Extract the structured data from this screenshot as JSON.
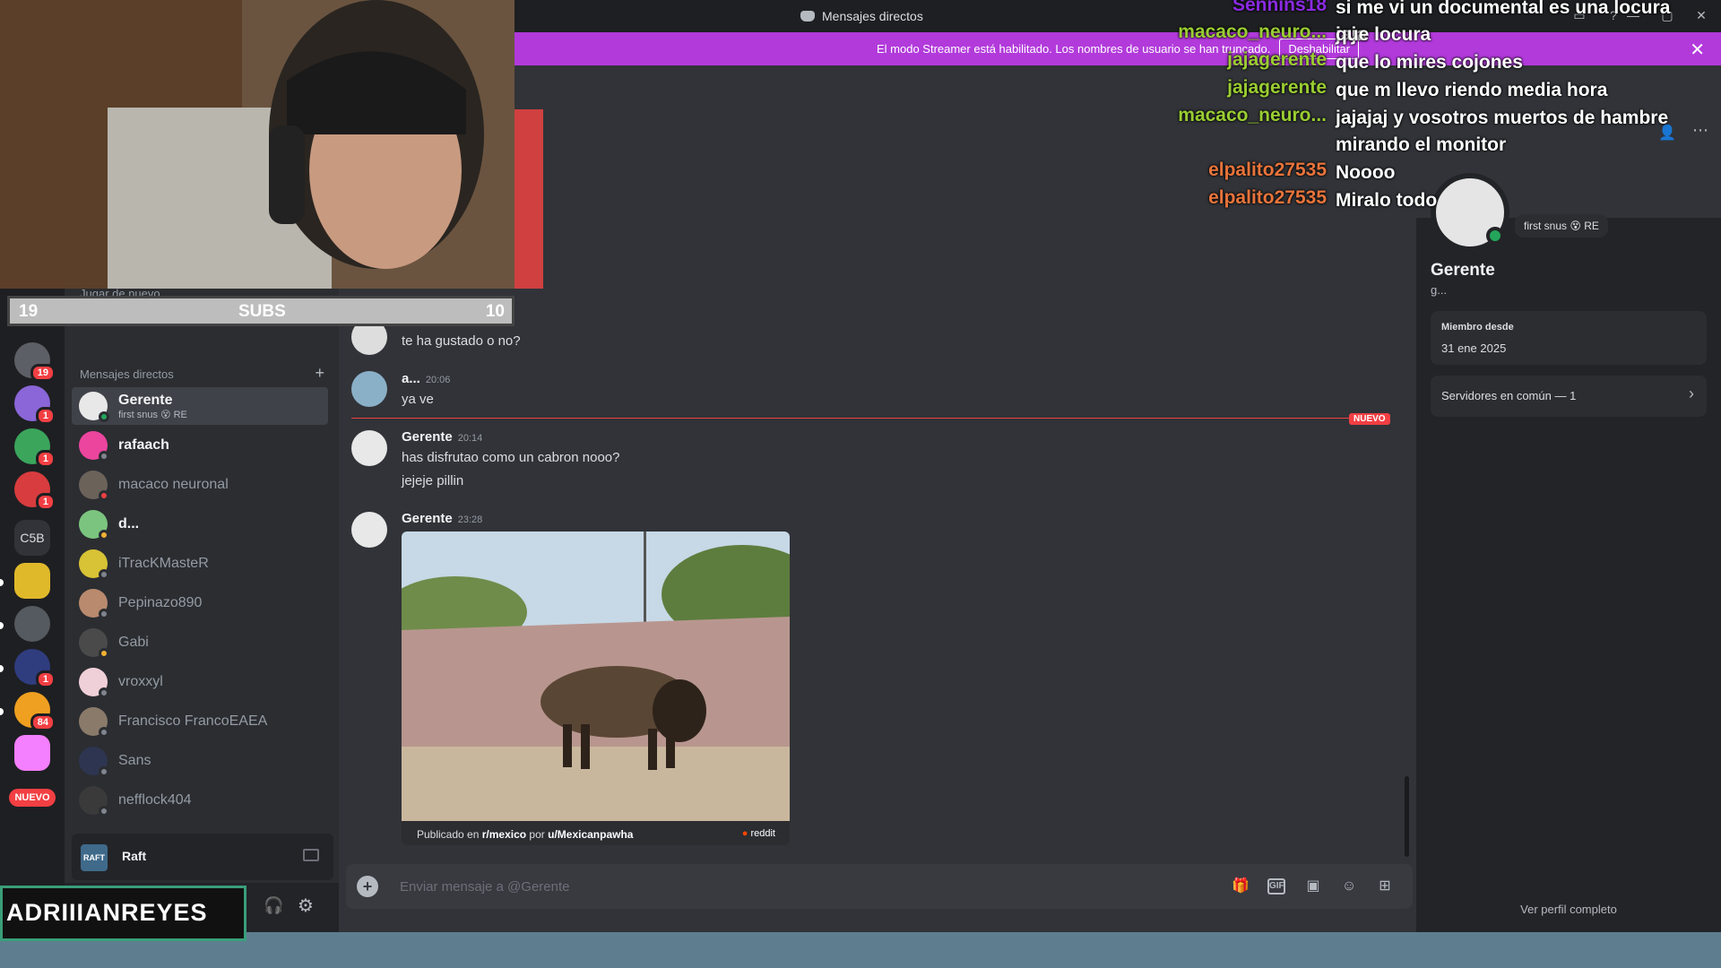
{
  "window": {
    "title": "Mensajes directos",
    "help_icon": "help-icon",
    "minimize_icon": "minimize-icon",
    "maximize_icon": "maximize-icon",
    "close_icon": "close-icon"
  },
  "streamer_banner": {
    "text": "El modo Streamer está habilitado. Los nombres de usuario se han truncado.",
    "button": "Deshabilitar"
  },
  "server_rail": {
    "badges": [
      "19",
      "1",
      "1",
      "1",
      "1",
      "84"
    ],
    "c5b_label": "C5B",
    "new_label": "NUEVO"
  },
  "sidebar": {
    "partial_label": "Jugar de nuevo",
    "dm_header": "Mensajes directos",
    "dms": [
      {
        "name": "Gerente",
        "sub": "first snus 😵 RE"
      },
      {
        "name": "rafaach"
      },
      {
        "name": "macaco neuronal"
      },
      {
        "name": "d..."
      },
      {
        "name": "iTracKMasteR"
      },
      {
        "name": "Pepinazo890"
      },
      {
        "name": "Gabi"
      },
      {
        "name": "vroxxyl"
      },
      {
        "name": "Francisco FrancoEAEA"
      },
      {
        "name": "Sans"
      },
      {
        "name": "nefflock404"
      }
    ],
    "activity": {
      "game": "Raft",
      "icon_text": "RAFT"
    }
  },
  "chat": {
    "messages": [
      {
        "text": "te ha gustado o no?"
      },
      {
        "author": "a...",
        "time": "20:06",
        "text": "ya ve"
      },
      {
        "author": "Gerente",
        "time": "20:14",
        "lines": [
          "has disfrutao como un cabron nooo?",
          "jejeje pillin"
        ]
      },
      {
        "author": "Gerente",
        "time": "23:28"
      }
    ],
    "new_marker": "NUEVO",
    "embed": {
      "caption_prefix": "Publicado en ",
      "subreddit": "r/mexico",
      "by": " por ",
      "user": "u/Mexicanpawha",
      "source": "reddit"
    },
    "composer_placeholder": "Enviar mensaje a @Gerente"
  },
  "profile": {
    "name": "Gerente",
    "tag": "g...",
    "status": "first snus 😵 RE",
    "member_since_label": "Miembro desde",
    "member_since": "31 ene 2025",
    "servers_label": "Servidores en común — 1",
    "view_full": "Ver perfil completo"
  },
  "overlay": {
    "subs_left": "19",
    "subs_label": "SUBS",
    "subs_right": "10",
    "streamer_name": "ADRIIIANREYES",
    "twitch_chat": [
      {
        "user": "Sennins18",
        "color": "#8a2be2",
        "msg": "si me vi un documental es una locura jaja"
      },
      {
        "user": "macaco_neuro...",
        "color": "#9acd32",
        "msg": "que locura"
      },
      {
        "user": "jajagerente",
        "color": "#9acd32",
        "msg": "que lo mires cojones"
      },
      {
        "user": "jajagerente",
        "color": "#9acd32",
        "msg": "que m llevo riendo media hora"
      },
      {
        "user": "macaco_neuro...",
        "color": "#9acd32",
        "msg": "jajajaj y vosotros muertos de hambre mirando el monitor"
      },
      {
        "user": "elpalito27535",
        "color": "#e8743b",
        "msg": "Noooo"
      },
      {
        "user": "elpalito27535",
        "color": "#e8743b",
        "msg": "Miralo todo"
      }
    ]
  }
}
